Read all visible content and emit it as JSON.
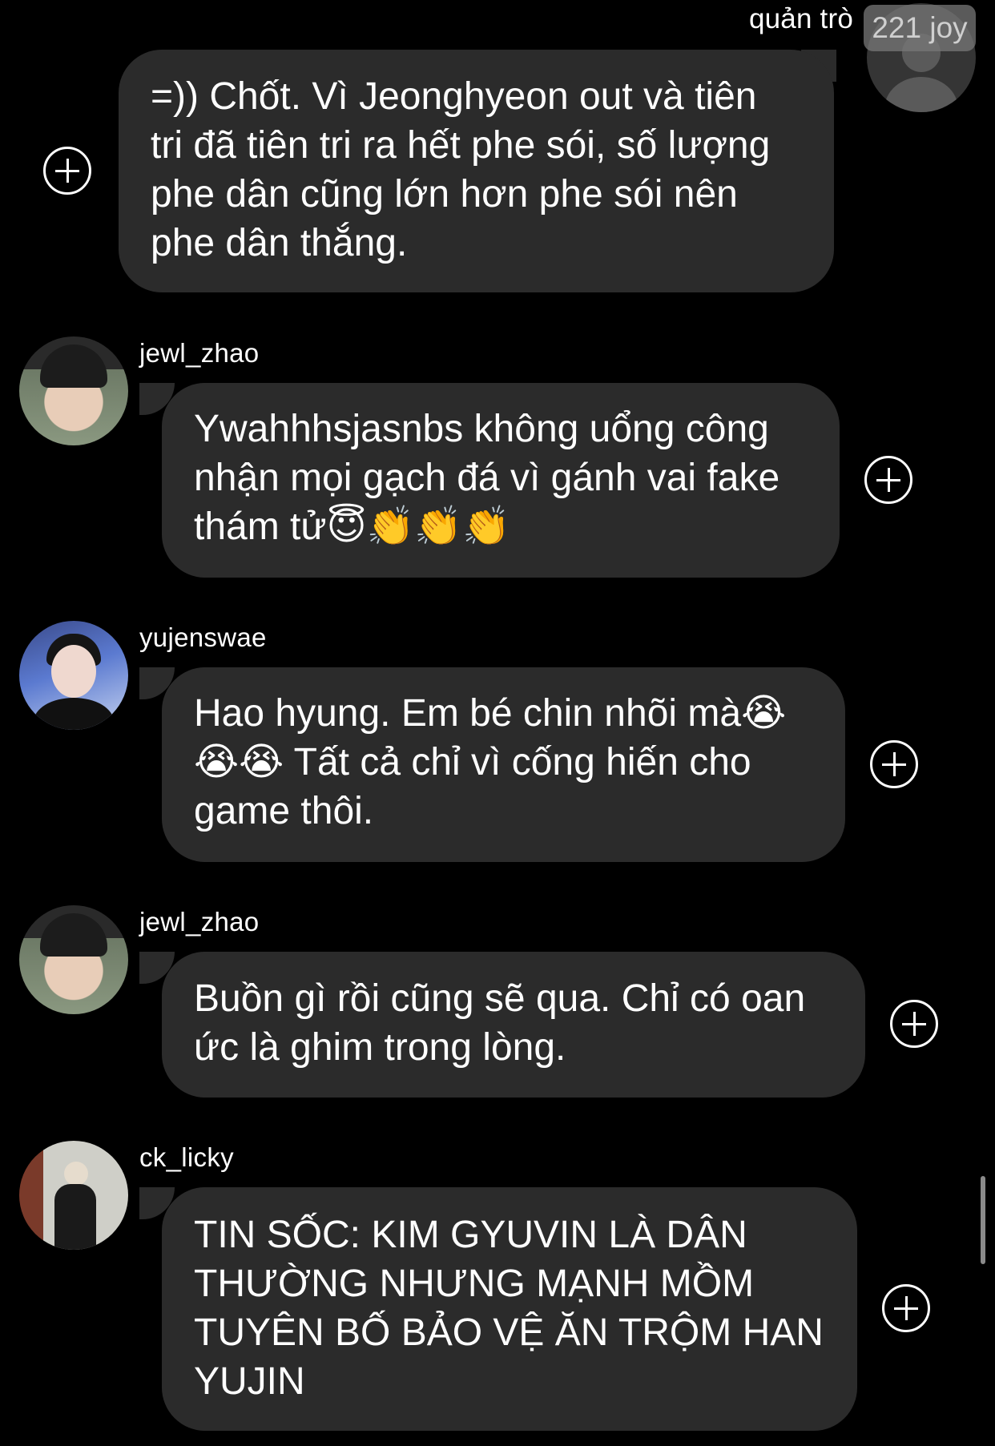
{
  "host": {
    "name": "quản trò",
    "tag": "221 joy"
  },
  "messages": [
    {
      "user": "",
      "text_lines": [
        "=)) Chốt. Vì Jeonghyeon out và tiên",
        "tri đã tiên tri ra hết phe sói, số lượng",
        "phe dân cũng lớn hơn phe sói nên",
        "phe dân thắng."
      ]
    },
    {
      "user": "jewl_zhao",
      "text_lines": [
        "Ywahhhsjasnbs không uổng công",
        "nhận mọi gạch đá vì gánh vai fake",
        "thám tử😇👏👏👏"
      ]
    },
    {
      "user": "yujenswae",
      "text_lines": [
        "Hao hyung. Em bé chin nhõi mà😭",
        "😭😭 Tất cả chỉ vì cống hiến cho",
        "game thôi."
      ]
    },
    {
      "user": "jewl_zhao",
      "text_lines": [
        "Buồn gì rồi cũng sẽ qua. Chỉ có oan",
        "ức là ghim trong lòng."
      ]
    },
    {
      "user": "ck_licky",
      "text_lines": [
        "TIN SỐC: KIM GYUVIN LÀ DÂN",
        "THƯỜNG NHƯNG MẠNH MỒM",
        "TUYÊN BỐ BẢO VỆ ĂN TRỘM HAN",
        "YUJIN"
      ]
    }
  ],
  "icons": {
    "add": "plus-circle-icon"
  },
  "colors": {
    "background": "#000000",
    "bubble": "#2b2b2b",
    "text": "#ffffff"
  }
}
